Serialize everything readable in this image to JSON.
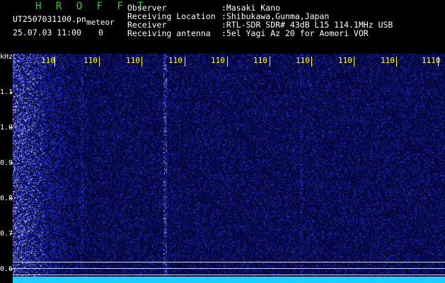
{
  "header": {
    "brand": "H R O F F T",
    "filename": "UT2507031100.pn",
    "mode": "meteor",
    "timestamp": "25.07.03 11:00",
    "counter": "0",
    "observer_label": "Observer",
    "observer_value": ":Masaki Kano",
    "location_label": "Receiving Location",
    "location_value": ":Shibukawa,Gunma,Japan",
    "receiver_label": "Receiver",
    "receiver_value": ":RTL-SDR SDR# 43dB L15 114.1MHz USB",
    "antenna_label": "Receiving antenna",
    "antenna_value": ":5el Yagi Az 20 for Aomori VOR"
  },
  "yaxis": {
    "unit": "kHz",
    "labels": [
      "1.1",
      "1.0",
      "0.9",
      "0.8",
      "0.7",
      "0.6"
    ]
  },
  "xaxis": {
    "labels": [
      "110",
      "110",
      "110",
      "110",
      "110",
      "110",
      "110",
      "110",
      "110",
      "1110"
    ]
  },
  "colors": {
    "background": "#000000",
    "waterfall_base": "#0a0a3a",
    "signal": "#3a4cff",
    "floor": "#1ad0ff",
    "time_ticks": "#ffff40",
    "brand": "#2bd42b"
  }
}
